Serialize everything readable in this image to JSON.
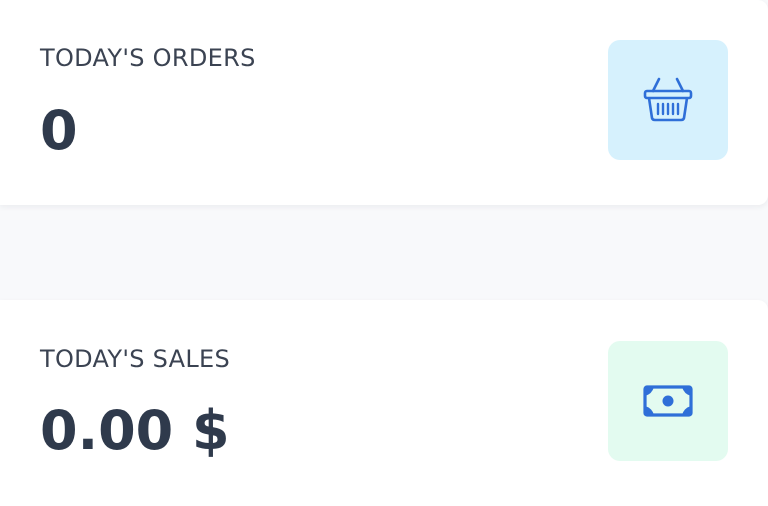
{
  "cards": [
    {
      "label": "TODAY'S ORDERS",
      "value": "0",
      "icon": "basket-icon",
      "tile_color": "#d6f1fd",
      "icon_color": "#2f6fd8"
    },
    {
      "label": "TODAY'S SALES",
      "value": "0.00 $",
      "icon": "cash-icon",
      "tile_color": "#e3fbf0",
      "icon_color": "#2f6fd8"
    }
  ]
}
